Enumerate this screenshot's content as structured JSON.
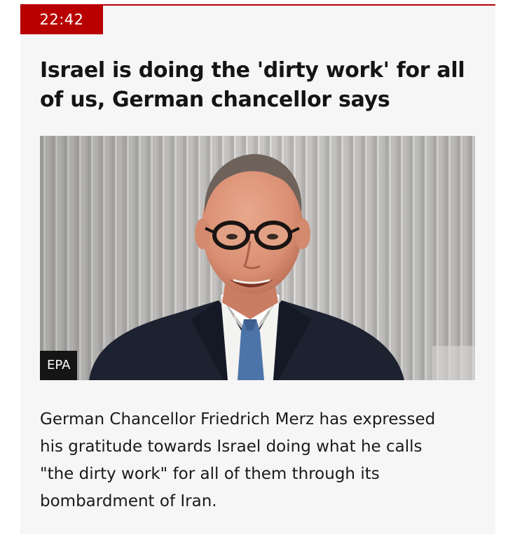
{
  "article": {
    "time": "22:42",
    "headline": "Israel is doing the 'dirty work' for all of us, German chancellor says",
    "image": {
      "credit": "EPA"
    },
    "summary": "German Chancellor Friedrich Merz has expressed his gratitude towards Israel doing what he calls \"the dirty work\" for all of them through its bombardment of Iran."
  },
  "colors": {
    "accent": "#b80000",
    "card_background": "#f6f6f6",
    "headline": "#141414",
    "credit_background": "#151515"
  }
}
